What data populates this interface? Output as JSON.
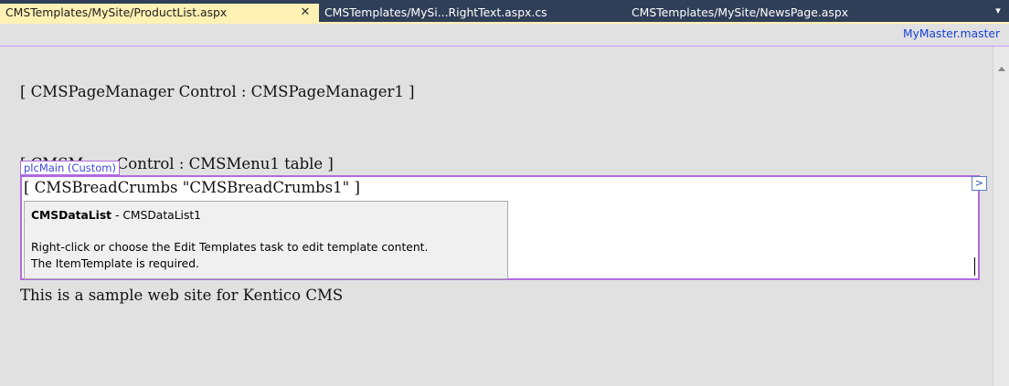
{
  "tabs": [
    {
      "label": "CMSTemplates/MySite/ProductList.aspx",
      "active": true
    },
    {
      "label": "CMSTemplates/MySi...RightText.aspx.cs",
      "active": false
    },
    {
      "label": "CMSTemplates/MySite/NewsPage.aspx",
      "active": false
    }
  ],
  "tab_close_glyph": "✕",
  "tab_dropdown_glyph": "▾",
  "master_page_link": "MyMaster.master",
  "design": {
    "page_manager": "[ CMSPageManager Control : CMSPageManager1 ]",
    "menu": "[ CMSMenu Control : CMSMenu1  table ]",
    "placeholder_tag": "plcMain (Custom)",
    "breadcrumbs": "[ CMSBreadCrumbs \"CMSBreadCrumbs1\" ]",
    "datalist": {
      "type": "CMSDataList",
      "separator": " - ",
      "id": "CMSDataList1",
      "message_line1": "Right-click or choose the Edit Templates task to edit template content.",
      "message_line2": "The ItemTemplate is required."
    },
    "footer_text": "This is a sample web site for Kentico CMS"
  },
  "smart_tag_glyph": ">",
  "colors": {
    "tabbar_bg": "#2f3f58",
    "active_tab_bg": "#fff1b3",
    "placeholder_border": "#b06ae0",
    "link": "#1a41d8"
  }
}
